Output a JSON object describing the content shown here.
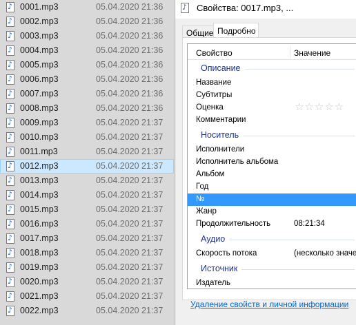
{
  "files": [
    {
      "name": "0001.mp3",
      "date": "05.04.2020 21:36"
    },
    {
      "name": "0002.mp3",
      "date": "05.04.2020 21:36"
    },
    {
      "name": "0003.mp3",
      "date": "05.04.2020 21:36"
    },
    {
      "name": "0004.mp3",
      "date": "05.04.2020 21:36"
    },
    {
      "name": "0005.mp3",
      "date": "05.04.2020 21:36"
    },
    {
      "name": "0006.mp3",
      "date": "05.04.2020 21:36"
    },
    {
      "name": "0007.mp3",
      "date": "05.04.2020 21:36"
    },
    {
      "name": "0008.mp3",
      "date": "05.04.2020 21:36"
    },
    {
      "name": "0009.mp3",
      "date": "05.04.2020 21:37"
    },
    {
      "name": "0010.mp3",
      "date": "05.04.2020 21:37"
    },
    {
      "name": "0011.mp3",
      "date": "05.04.2020 21:37"
    },
    {
      "name": "0012.mp3",
      "date": "05.04.2020 21:37"
    },
    {
      "name": "0013.mp3",
      "date": "05.04.2020 21:37"
    },
    {
      "name": "0014.mp3",
      "date": "05.04.2020 21:37"
    },
    {
      "name": "0015.mp3",
      "date": "05.04.2020 21:37"
    },
    {
      "name": "0016.mp3",
      "date": "05.04.2020 21:37"
    },
    {
      "name": "0017.mp3",
      "date": "05.04.2020 21:37"
    },
    {
      "name": "0018.mp3",
      "date": "05.04.2020 21:37"
    },
    {
      "name": "0019.mp3",
      "date": "05.04.2020 21:37"
    },
    {
      "name": "0020.mp3",
      "date": "05.04.2020 21:37"
    },
    {
      "name": "0021.mp3",
      "date": "05.04.2020 21:37"
    },
    {
      "name": "0022.mp3",
      "date": "05.04.2020 21:37"
    }
  ],
  "selected_file": "0012.mp3",
  "file_icon": "audio-file-icon",
  "dialog": {
    "title": "Свойства: 0017.mp3, ...",
    "tabs": [
      {
        "label": "Общие",
        "active": false
      },
      {
        "label": "Подробно",
        "active": true
      }
    ],
    "columns": {
      "property": "Свойство",
      "value": "Значение"
    },
    "groups": [
      {
        "label": "Описание",
        "rows": [
          {
            "name": "Название",
            "value": ""
          },
          {
            "name": "Субтитры",
            "value": ""
          },
          {
            "name": "Оценка",
            "value": "",
            "stars": "☆☆☆☆☆"
          },
          {
            "name": "Комментарии",
            "value": ""
          }
        ]
      },
      {
        "label": "Носитель",
        "rows": [
          {
            "name": "Исполнители",
            "value": ""
          },
          {
            "name": "Исполнитель альбома",
            "value": ""
          },
          {
            "name": "Альбом",
            "value": ""
          },
          {
            "name": "Год",
            "value": ""
          },
          {
            "name": "№",
            "value": "",
            "selected": true
          },
          {
            "name": "Жанр",
            "value": ""
          },
          {
            "name": "Продолжительность",
            "value": "08:21:34"
          }
        ]
      },
      {
        "label": "Аудио",
        "rows": [
          {
            "name": "Скорость потока",
            "value": "(несколько значен"
          }
        ]
      },
      {
        "label": "Источник",
        "rows": [
          {
            "name": "Издатель",
            "value": ""
          }
        ]
      }
    ],
    "remove_link": "Удаление свойств и личной информации"
  },
  "colors": {
    "accent": "#3399ff",
    "group_label": "#1e3287",
    "link": "#0066cc",
    "selection": "#cce8ff"
  }
}
